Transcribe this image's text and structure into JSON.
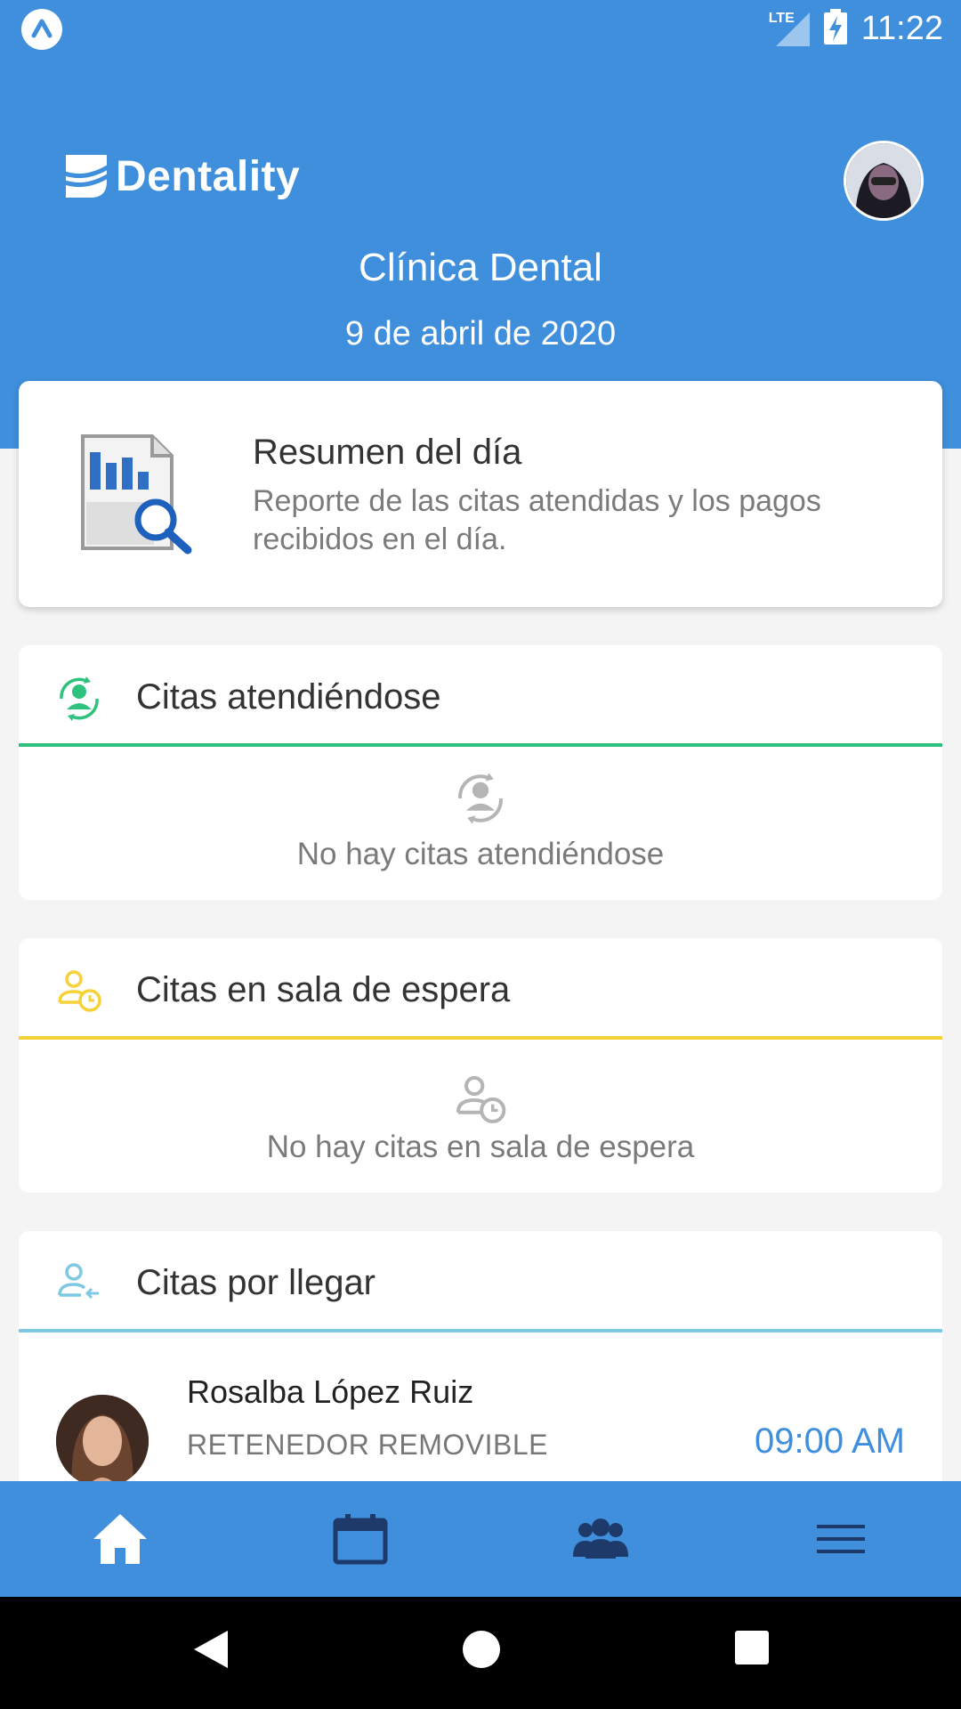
{
  "status_bar": {
    "time": "11:22",
    "network": "LTE",
    "app_indicator_icon": "app-indicator-icon",
    "signal_icon": "signal-icon",
    "battery_icon": "battery-charging-icon"
  },
  "header": {
    "logo_text": "Dentality",
    "logo_icon": "tooth-logo-icon",
    "clinic_name": "Clínica Dental",
    "date": "9 de abril de 2020",
    "avatar": "user-avatar"
  },
  "summary": {
    "title": "Resumen del día",
    "description": "Reporte de las citas atendidas y los pagos recibidos en el día.",
    "icon": "report-search-icon"
  },
  "sections": {
    "attending": {
      "title": "Citas atendiéndose",
      "empty_text": "No hay citas atendiéndose",
      "icon": "patient-rotate-icon",
      "accent_color": "#2ec27e"
    },
    "waiting_room": {
      "title": "Citas en sala de espera",
      "empty_text": "No hay citas en sala de espera",
      "icon": "patient-clock-icon",
      "accent_color": "#f6d137"
    },
    "arriving": {
      "title": "Citas por llegar",
      "icon": "patient-arrive-icon",
      "accent_color": "#7fc8e3",
      "appointments": [
        {
          "name": "Rosalba López Ruiz",
          "treatment": "RETENEDOR REMOVIBLE",
          "time": "09:00 AM"
        }
      ]
    }
  },
  "bottom_nav": {
    "items": [
      "home-icon",
      "calendar-icon",
      "patients-icon",
      "menu-icon"
    ],
    "active": "home-icon"
  },
  "system_nav": [
    "back-icon",
    "home-circle-icon",
    "recents-icon"
  ],
  "colors": {
    "primary": "#3f8fdc",
    "background": "#f4f4f4"
  }
}
